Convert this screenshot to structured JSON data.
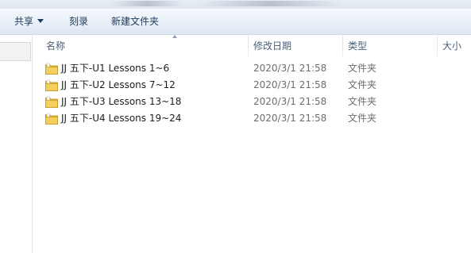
{
  "toolbar": {
    "share_label": "共享",
    "burn_label": "刻录",
    "new_folder_label": "新建文件夹"
  },
  "columns": {
    "name": "名称",
    "date_modified": "修改日期",
    "type": "类型",
    "size": "大小"
  },
  "files": [
    {
      "name": "JJ 五下-U1 Lessons 1~6",
      "date": "2020/3/1 21:58",
      "type": "文件夹",
      "icon": "folder-icon"
    },
    {
      "name": "JJ 五下-U2 Lessons 7~12",
      "date": "2020/3/1 21:58",
      "type": "文件夹",
      "icon": "folder-icon"
    },
    {
      "name": "JJ 五下-U3 Lessons 13~18",
      "date": "2020/3/1 21:58",
      "type": "文件夹",
      "icon": "folder-icon"
    },
    {
      "name": "JJ 五下-U4 Lessons 19~24",
      "date": "2020/3/1 21:58",
      "type": "文件夹",
      "icon": "folder-icon"
    }
  ],
  "colors": {
    "toolbar_text": "#1e395b",
    "header_text": "#4c607a",
    "muted_text": "#6d6d6d",
    "folder_yellow": "#f3cf5b"
  }
}
